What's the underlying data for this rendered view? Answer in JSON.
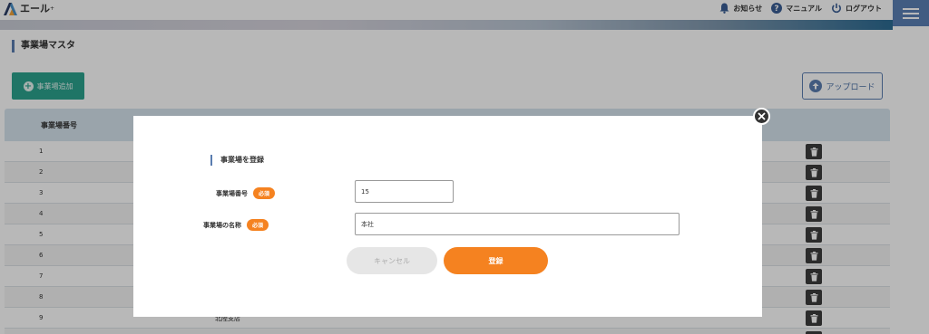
{
  "header": {
    "logo_text": "エール",
    "logo_sup": "+",
    "nav": [
      {
        "icon": "bell-icon",
        "label": "お知らせ"
      },
      {
        "icon": "question-icon",
        "label": "マニュアル"
      },
      {
        "icon": "power-icon",
        "label": "ログアウト"
      }
    ]
  },
  "page": {
    "title": "事業場マスタ",
    "add_button": "事業場追加",
    "upload_button": "アップロード"
  },
  "table": {
    "columns": [
      "事業場番号"
    ],
    "rows": [
      {
        "num": "1",
        "name": ""
      },
      {
        "num": "2",
        "name": ""
      },
      {
        "num": "3",
        "name": ""
      },
      {
        "num": "4",
        "name": ""
      },
      {
        "num": "5",
        "name": ""
      },
      {
        "num": "6",
        "name": ""
      },
      {
        "num": "7",
        "name": ""
      },
      {
        "num": "8",
        "name": ""
      },
      {
        "num": "9",
        "name": "北陸支店"
      },
      {
        "num": "",
        "name": ""
      }
    ]
  },
  "modal": {
    "title": "事業場を登録",
    "fields": [
      {
        "label": "事業場番号",
        "required": "必須",
        "value": "15"
      },
      {
        "label": "事業場の名称",
        "required": "必須",
        "value": "本社"
      }
    ],
    "cancel": "キャンセル",
    "submit": "登録"
  },
  "colors": {
    "accent_orange": "#f58220",
    "accent_teal": "#2ba28e",
    "accent_blue": "#5a7db0"
  }
}
